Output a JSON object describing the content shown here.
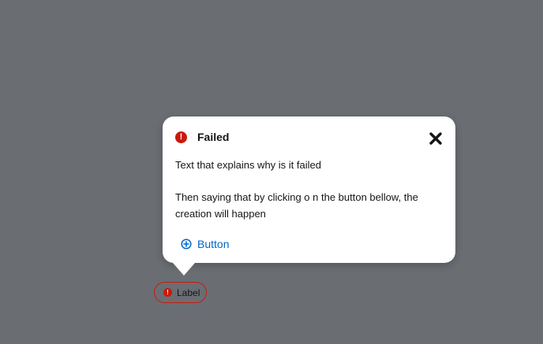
{
  "popover": {
    "title": "Failed",
    "body": {
      "paragraph_1": "Text that explains why is it failed",
      "paragraph_2": "Then saying that by clicking o n the button bellow, the creation will happen"
    },
    "action_label": "Button",
    "icons": {
      "status": "exclamation-circle-icon",
      "close": "close-icon",
      "action": "plus-circle-icon"
    }
  },
  "label": {
    "text": "Label",
    "icon": "exclamation-circle-icon"
  },
  "colors": {
    "overlay": "#6a6e73",
    "danger": "#c9190b",
    "link": "#0066cc",
    "surface": "#ffffff",
    "text": "#151515"
  }
}
